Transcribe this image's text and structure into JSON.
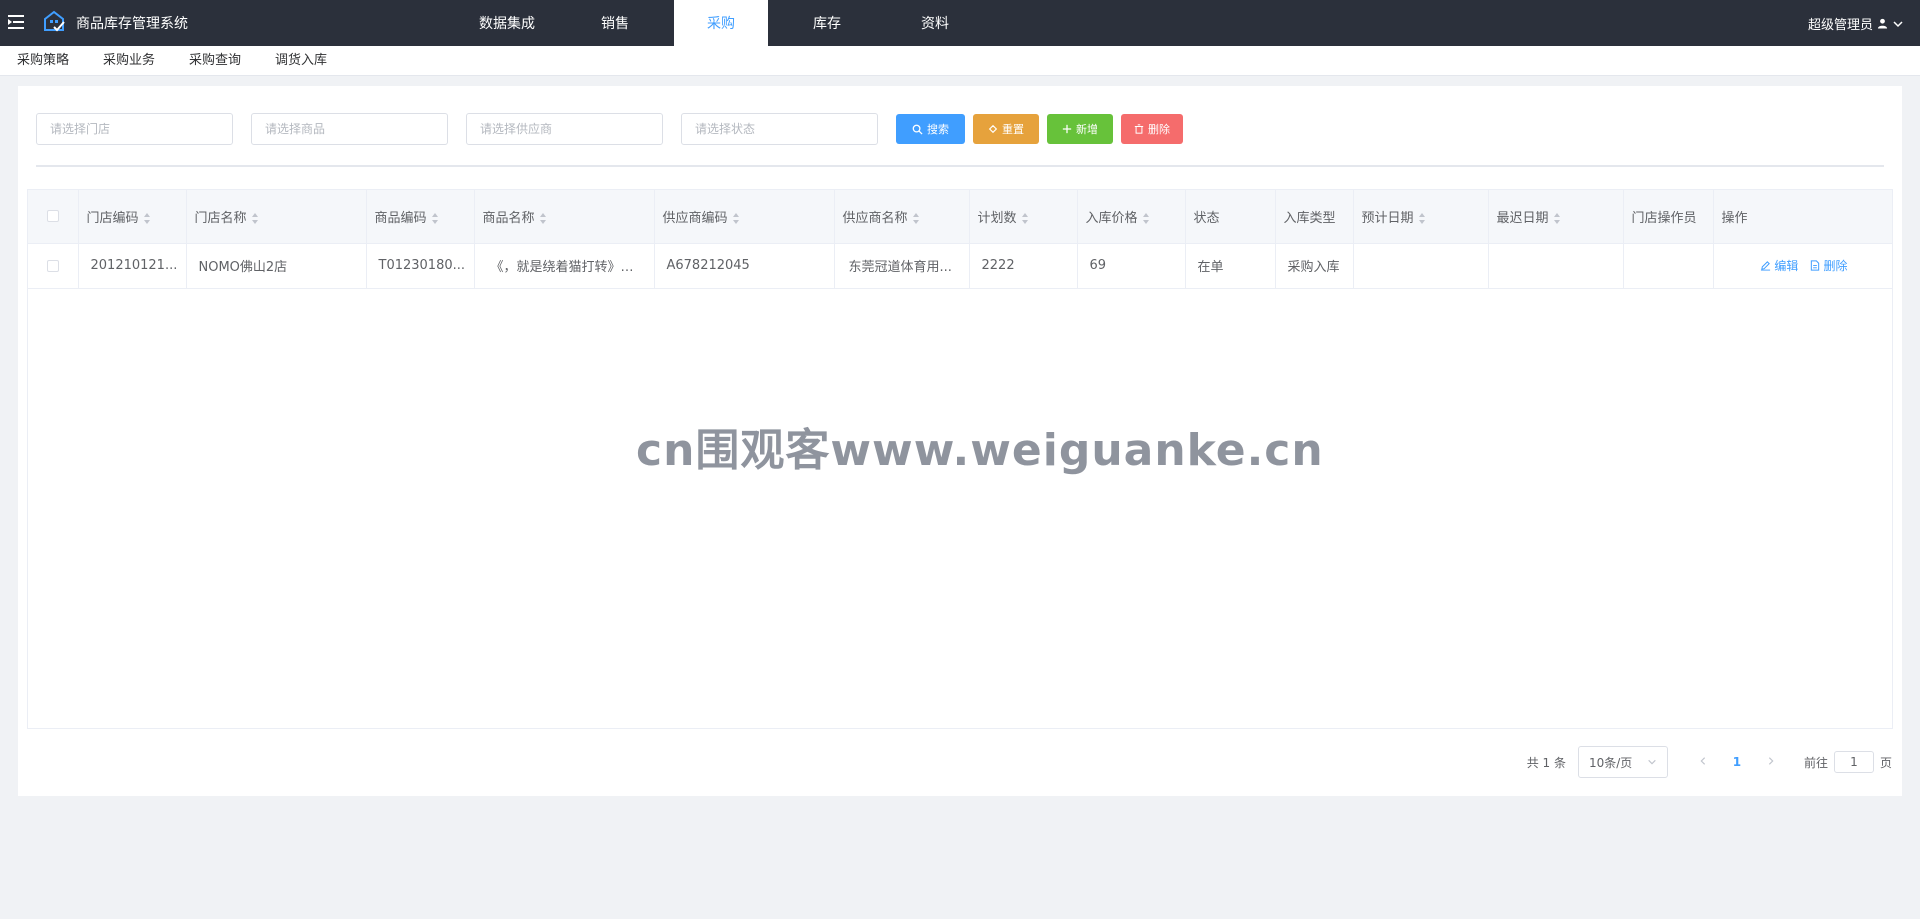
{
  "app": {
    "title": "商品库存管理系统",
    "brand_color": "#2b303b",
    "accent_color": "#409eff"
  },
  "nav": {
    "tabs": [
      "数据集成",
      "销售",
      "采购",
      "库存",
      "资料"
    ],
    "active": "采购"
  },
  "user": {
    "name": "超级管理员",
    "icon": "user-icon"
  },
  "subnav": {
    "items": [
      "采购策略",
      "采购业务",
      "采购查询",
      "调货入库"
    ]
  },
  "filters": {
    "store_placeholder": "请选择门店",
    "product_placeholder": "请选择商品",
    "supplier_placeholder": "请选择供应商",
    "status_placeholder": "请选择状态"
  },
  "buttons": {
    "search": "搜索",
    "reset": "重置",
    "add": "新增",
    "delete": "删除",
    "search_color": "#409eff",
    "reset_color": "#e6a23c",
    "add_color": "#67c23a",
    "delete_color": "#f56c6c"
  },
  "table": {
    "columns": [
      "门店编码",
      "门店名称",
      "商品编码",
      "商品名称",
      "供应商编码",
      "供应商名称",
      "计划数",
      "入库价格",
      "状态",
      "入库类型",
      "预计日期",
      "最迟日期",
      "门店操作员",
      "操作"
    ],
    "rows": [
      {
        "store_code": "201210121...",
        "store_name": "NOMO佛山2店",
        "product_code": "T01230180...",
        "product_name": "《，就是绕着猫打转》系...",
        "supplier_code": "A678212045",
        "supplier_name": "东莞冠道体育用...",
        "plan_qty": "2222",
        "price": "69",
        "status": "在单",
        "type": "采购入库",
        "expected_date": "",
        "latest_date": "",
        "operator": "",
        "edit": "编辑",
        "delete": "删除"
      }
    ]
  },
  "watermark": "cn围观客www.weiguanke.cn",
  "pagination": {
    "total": "共 1 条",
    "page_size": "10条/页",
    "current": "1",
    "goto_label": "前往",
    "goto_value": "1",
    "page_unit": "页"
  }
}
